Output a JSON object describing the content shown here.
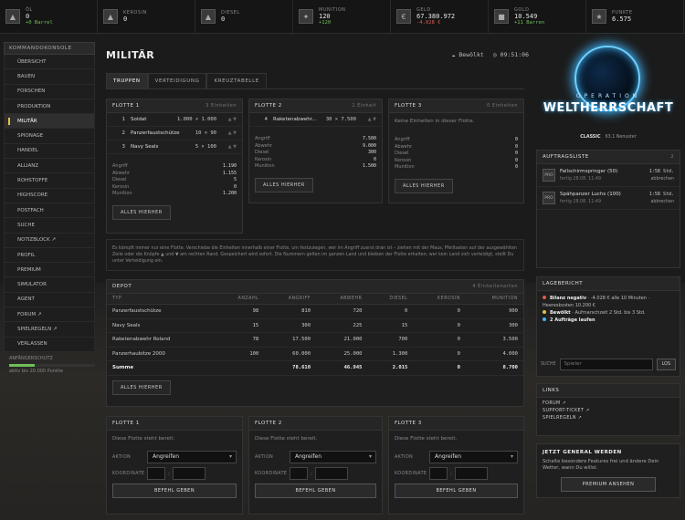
{
  "resources": [
    {
      "label": "ÖL",
      "value": "0",
      "sub": "+0 Barrel",
      "sub_color": "green",
      "icon": "oil-icon",
      "glyph": "▲"
    },
    {
      "label": "KEROSIN",
      "value": "0",
      "sub": "",
      "sub_color": "",
      "icon": "kerosene-icon",
      "glyph": "▲"
    },
    {
      "label": "DIESEL",
      "value": "0",
      "sub": "",
      "sub_color": "",
      "icon": "diesel-icon",
      "glyph": "▲"
    },
    {
      "label": "MUNITION",
      "value": "120",
      "sub": "+120",
      "sub_color": "green",
      "icon": "ammo-icon",
      "glyph": "✦"
    },
    {
      "label": "GELD",
      "value": "67.380.972",
      "sub": "-4.028 €",
      "sub_color": "red",
      "icon": "money-icon",
      "glyph": "€"
    },
    {
      "label": "GOLD",
      "value": "10.549",
      "sub": "+11 Barren",
      "sub_color": "green",
      "icon": "gold-icon",
      "glyph": "■"
    },
    {
      "label": "PUNKTE",
      "value": "6.575",
      "sub": "",
      "sub_color": "",
      "icon": "points-icon",
      "glyph": "★"
    }
  ],
  "sidebar": {
    "header": "KOMMANDOKONSOLE",
    "items": [
      "ÜBERSICHT",
      "BAUEN",
      "FORSCHEN",
      "PRODUKTION",
      "MILITÄR",
      "SPIONAGE",
      "HANDEL",
      "ALLIANZ",
      "ROHSTOFFE",
      "HIGHSCORE",
      "POSTFACH",
      "SUCHE",
      "NOTIZBLOCK ↗",
      "PROFIL",
      "PREMIUM",
      "SIMULATOR",
      "AGENT",
      "FORUM ↗",
      "SPIELREGELN ↗",
      "VERLASSEN"
    ],
    "active_index": 4,
    "newbie_title": "ANFÄNGERSCHUTZ",
    "newbie_text": "aktiv bis 20.000 Punkte",
    "newbie_progress": 0.3
  },
  "page": {
    "title": "MILITÄR",
    "weather": "☁ Bewölkt",
    "time": "◷ 09:51:06"
  },
  "tabs": [
    "TRUPPEN",
    "VERTEIDIGUNG",
    "KREUZTABELLE"
  ],
  "fleets": [
    {
      "name": "FLOTTE 1",
      "count": "3 Einheiten",
      "units": [
        {
          "q": "1",
          "n": "Soldat",
          "d": "1.000 × 1.000"
        },
        {
          "q": "2",
          "n": "Panzerfaustschütze",
          "d": "10 × 90"
        },
        {
          "q": "3",
          "n": "Navy Seals",
          "d": "5 × 100"
        }
      ],
      "stats": [
        [
          "Angriff",
          "1.190"
        ],
        [
          "Abwehr",
          "1.155"
        ],
        [
          "Diesel",
          "5"
        ],
        [
          "Kerosin",
          "0"
        ],
        [
          "Munition",
          "1.200"
        ]
      ],
      "empty": "",
      "button": "ALLES HIERHER"
    },
    {
      "name": "FLOTTE 2",
      "count": "1 Einheit",
      "units": [
        {
          "q": "4",
          "n": "Raketenabwehr...",
          "d": "30 × 7.500"
        }
      ],
      "stats": [
        [
          "Angriff",
          "7.500"
        ],
        [
          "Abwehr",
          "9.000"
        ],
        [
          "Diesel",
          "300"
        ],
        [
          "Kerosin",
          "0"
        ],
        [
          "Munition",
          "1.500"
        ]
      ],
      "empty": "",
      "button": "ALLES HIERHER"
    },
    {
      "name": "FLOTTE 3",
      "count": "0 Einheiten",
      "units": [],
      "stats": [
        [
          "Angriff",
          "0"
        ],
        [
          "Abwehr",
          "0"
        ],
        [
          "Diesel",
          "0"
        ],
        [
          "Kerosin",
          "0"
        ],
        [
          "Munition",
          "0"
        ]
      ],
      "empty": "Keine Einheiten in dieser Flotte.",
      "button": "ALLES HIERHER"
    }
  ],
  "info_text": "Es kämpft immer nur eine Flotte. Verschiebe die Einheiten innerhalb einer Flotte, um festzulegen, wer im Angriff zuerst dran ist – ziehen mit der Maus, Pfeiltasten auf der ausgewählten Zeile oder die Knöpfe ▲ und ▼ am rechten Rand. Gespeichert wird sofort. Die Nummern gelten im ganzen Land und bleiben der Flotte erhalten; wer kein Land sich verteidigt, stellt Du unter Verteidigung ein.",
  "depot": {
    "title": "DEPOT",
    "count": "4 Einheitenarten",
    "headers": [
      "TYP",
      "ANZAHL",
      "ANGRIFF",
      "ABWEHR",
      "DIESEL",
      "KEROSIN",
      "MUNITION"
    ],
    "rows": [
      [
        "Panzerfaustschütze",
        "98",
        "810",
        "720",
        "0",
        "0",
        "900"
      ],
      [
        "Navy Seals",
        "15",
        "300",
        "225",
        "15",
        "0",
        "300"
      ],
      [
        "Raketenabwehr Roland",
        "78",
        "17.500",
        "21.000",
        "700",
        "0",
        "3.500"
      ],
      [
        "Panzerhaubitze 2000",
        "100",
        "60.000",
        "25.000",
        "1.300",
        "0",
        "4.000"
      ]
    ],
    "sum": [
      "Summe",
      "",
      "78.610",
      "46.945",
      "2.015",
      "0",
      "8.700"
    ],
    "button": "ALLES HIERHER"
  },
  "dispatch": [
    {
      "name": "FLOTTE 1",
      "status": "Diese Flotte steht bereit.",
      "action_label": "AKTION",
      "action": "Angreifen",
      "coord_label": "KOORDINATE",
      "button": "BEFEHL GEBEN"
    },
    {
      "name": "FLOTTE 2",
      "status": "Diese Flotte steht bereit.",
      "action_label": "AKTION",
      "action": "Angreifen",
      "coord_label": "KOORDINATE",
      "button": "BEFEHL GEBEN"
    },
    {
      "name": "FLOTTE 3",
      "status": "Diese Flotte steht bereit.",
      "action_label": "AKTION",
      "action": "Angreifen",
      "coord_label": "KOORDINATE",
      "button": "BEFEHL GEBEN"
    }
  ],
  "logo": {
    "line1": "OPERATION",
    "line2": "WELTHERRSCHAFT",
    "classic": "CLASSIC",
    "version": "63.1 Nenuster"
  },
  "orders": {
    "title": "AUFTRAGSLISTE",
    "count": "2",
    "items": [
      {
        "badge": "PRO",
        "name": "Fallschirmspringer (50)",
        "sub": "fertig 28.08. 11:49",
        "time": "1:58 Std.",
        "action": "abbrechen"
      },
      {
        "badge": "PRO",
        "name": "Spähpanzer Luchs (100)",
        "sub": "fertig 28.08. 11:49",
        "time": "1:58 Std.",
        "action": "abbrechen"
      }
    ]
  },
  "report": {
    "title": "LAGEBERICHT",
    "lines": [
      {
        "color": "#e05a4a",
        "bold": "Bilanz negativ",
        "text": " · -4.028 € alle 10 Minuten · Heereskosten 10.200 €"
      },
      {
        "color": "#e5c04a",
        "bold": "Bewölkt",
        "text": " · Aufmarschzeit 2 Std. bis 3 Std."
      },
      {
        "color": "#3fb6ff",
        "bold": "2 Aufträge laufen",
        "text": ""
      }
    ]
  },
  "search": {
    "label": "SUCHE",
    "placeholder": "Spieler",
    "button": "LOS"
  },
  "links": {
    "title": "LINKS",
    "items": [
      "FORUM ↗",
      "SUPPORT-TICKET ↗",
      "SPIELREGELN ↗"
    ]
  },
  "promo": {
    "title": "JETZT GENERAL WERDEN",
    "text": "Schalte besondere Features frei und ändere Dein Wetter, wann Du willst.",
    "button": "PREMIUM ANSEHEN"
  }
}
